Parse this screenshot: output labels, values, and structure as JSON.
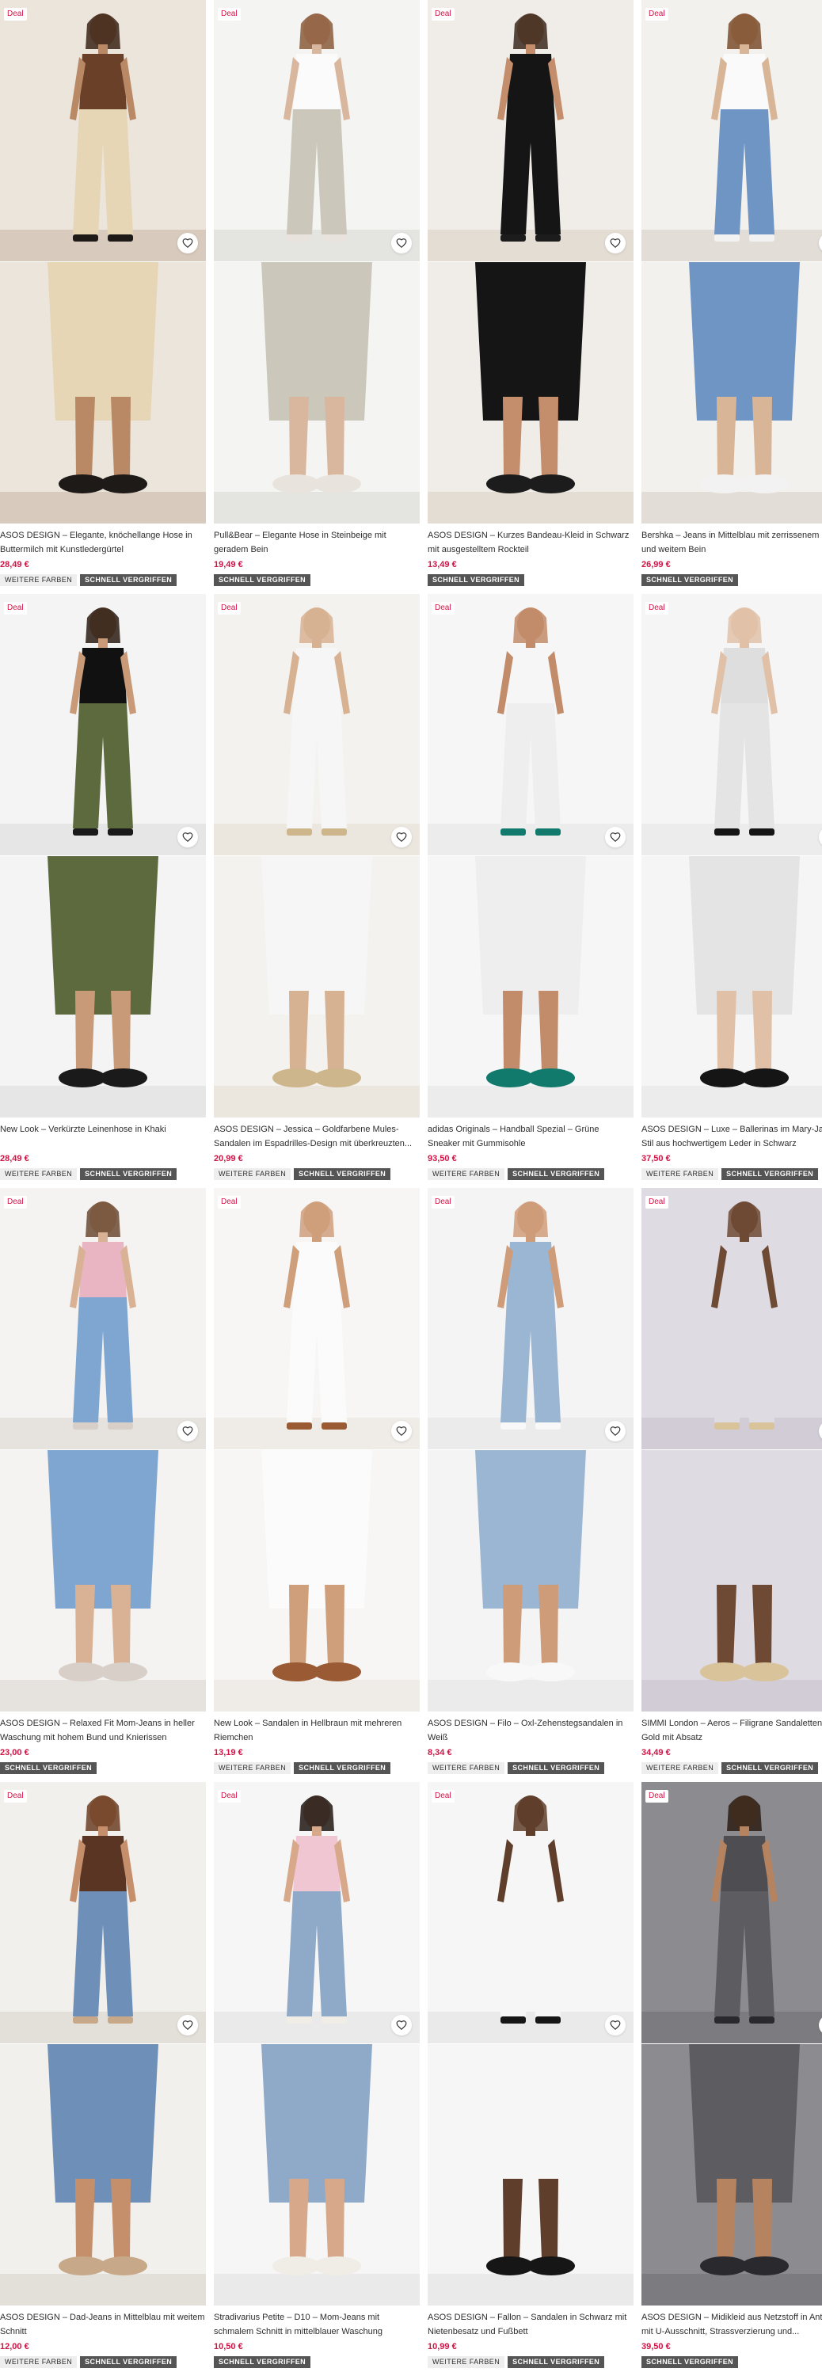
{
  "products": [
    {
      "deal": "Deal",
      "title": "ASOS DESIGN – Elegante, knöchellange Hose in Buttermilch mit Kunstledergürtel",
      "price": "28,49 €",
      "badges": [
        "WEITERE FARBEN",
        "SCHNELL VERGRIFFEN"
      ],
      "colors": {
        "bg": "#ece5dc",
        "floor": "#d8cbbd",
        "skin": "#b98966",
        "top": "#6b4028",
        "bottom": "#e6d6b6",
        "shoe": "#1e1a18",
        "hair": "#3b2416"
      }
    },
    {
      "deal": "Deal",
      "title": "Pull&Bear – Elegante Hose in Steinbeige mit geradem Bein",
      "price": "19,49 €",
      "badges": [
        "SCHNELL VERGRIFFEN"
      ],
      "colors": {
        "bg": "#f4f4f2",
        "floor": "#e4e4e1",
        "skin": "#d9b69e",
        "top": "#fbfbfb",
        "bottom": "#cbc8bb",
        "shoe": "#e8e4dd",
        "hair": "#8a5b3a"
      }
    },
    {
      "deal": "Deal",
      "title": "ASOS DESIGN – Kurzes Bandeau-Kleid in Schwarz mit ausgestelltem Rockteil",
      "price": "13,49 €",
      "badges": [
        "SCHNELL VERGRIFFEN"
      ],
      "colors": {
        "bg": "#f0ede9",
        "floor": "#e4ddd4",
        "skin": "#c48e6c",
        "top": "#151515",
        "bottom": "#151515",
        "shoe": "#1c1c1c",
        "hair": "#3b281c"
      }
    },
    {
      "deal": "Deal",
      "title": "Bershka – Jeans in Mittelblau mit zerrissenem Knie und weitem Bein",
      "price": "26,99 €",
      "badges": [
        "SCHNELL VERGRIFFEN"
      ],
      "colors": {
        "bg": "#f3f1ee",
        "floor": "#e2ddd6",
        "skin": "#d9b598",
        "top": "#fafafa",
        "bottom": "#6f95c4",
        "shoe": "#f2f2f2",
        "hair": "#7a4d2c"
      }
    },
    {
      "deal": "Deal",
      "title": "New Look – Verkürzte Leinenhose in Khaki",
      "price": "28,49 €",
      "badges": [
        "WEITERE FARBEN",
        "SCHNELL VERGRIFFEN"
      ],
      "colors": {
        "bg": "#f4f4f4",
        "floor": "#e6e6e6",
        "skin": "#c99a78",
        "top": "#111111",
        "bottom": "#5d6a3e",
        "shoe": "#1a1a1a",
        "hair": "#2a1b12"
      }
    },
    {
      "deal": "Deal",
      "title": "ASOS DESIGN – Jessica – Goldfarbene Mules-Sandalen im Espadrilles-Design mit überkreuzten...",
      "price": "20,99 €",
      "badges": [
        "WEITERE FARBEN",
        "SCHNELL VERGRIFFEN"
      ],
      "colors": {
        "bg": "#f4f2ee",
        "floor": "#ebe6de",
        "skin": "#d7b292",
        "top": "#f6f6f6",
        "bottom": "#f6f6f6",
        "shoe": "#cdb58c",
        "hair": "#d7b292"
      }
    },
    {
      "deal": "Deal",
      "title": "adidas Originals – Handball Spezial – Grüne Sneaker mit Gummisohle",
      "price": "93,50 €",
      "badges": [
        "WEITERE FARBEN",
        "SCHNELL VERGRIFFEN"
      ],
      "colors": {
        "bg": "#f6f6f6",
        "floor": "#ececec",
        "skin": "#c28c6a",
        "top": "#f6f6f6",
        "bottom": "#eeeeee",
        "shoe": "#117a6c",
        "hair": "#c28c6a"
      }
    },
    {
      "deal": "Deal",
      "title": "ASOS DESIGN – Luxe – Ballerinas im Mary-Jane-Stil aus hochwertigem Leder in Schwarz",
      "price": "37,50 €",
      "badges": [
        "WEITERE FARBEN",
        "SCHNELL VERGRIFFEN"
      ],
      "colors": {
        "bg": "#f5f5f5",
        "floor": "#ececec",
        "skin": "#e0c1a8",
        "top": "#dedede",
        "bottom": "#e4e4e4",
        "shoe": "#151515",
        "hair": "#e0c1a8"
      }
    },
    {
      "deal": "Deal",
      "title": "ASOS DESIGN – Relaxed Fit Mom-Jeans in heller Waschung mit hohem Bund und Knierissen",
      "price": "23,00 €",
      "badges": [
        "SCHNELL VERGRIFFEN"
      ],
      "colors": {
        "bg": "#f4f3f1",
        "floor": "#e6e3de",
        "skin": "#d9b295",
        "top": "#e9b5c3",
        "bottom": "#7ea6d1",
        "shoe": "#d8d0c8",
        "hair": "#6b4a33"
      }
    },
    {
      "deal": "Deal",
      "title": "New Look – Sandalen in Hellbraun mit mehreren Riemchen",
      "price": "13,19 €",
      "badges": [
        "WEITERE FARBEN",
        "SCHNELL VERGRIFFEN"
      ],
      "colors": {
        "bg": "#f7f6f4",
        "floor": "#efebe6",
        "skin": "#cf9f7c",
        "top": "#fbfbfb",
        "bottom": "#fbfbfb",
        "shoe": "#9a5a34",
        "hair": "#cf9f7c"
      }
    },
    {
      "deal": "Deal",
      "title": "ASOS DESIGN – Filo – Oxl-Zehenstegsandalen in Weiß",
      "price": "8,34 €",
      "badges": [
        "WEITERE FARBEN",
        "SCHNELL VERGRIFFEN"
      ],
      "colors": {
        "bg": "#f4f4f4",
        "floor": "#ebebeb",
        "skin": "#cf9c7a",
        "top": "#9ab6d3",
        "bottom": "#9ab6d3",
        "shoe": "#f8f8f8",
        "hair": "#cf9c7a"
      }
    },
    {
      "deal": "Deal",
      "title": "SIMMI London – Aeros – Filigrane Sandaletten in Gold mit Absatz",
      "price": "34,49 €",
      "badges": [
        "WEITERE FARBEN",
        "SCHNELL VERGRIFFEN"
      ],
      "colors": {
        "bg": "#dfdbe3",
        "floor": "#d2ccd7",
        "skin": "#6e4a35",
        "top": "#dfdbe3",
        "bottom": "#dfdbe3",
        "shoe": "#d9c39a",
        "hair": "#6e4a35"
      }
    },
    {
      "deal": "Deal",
      "title": "ASOS DESIGN – Dad-Jeans in Mittelblau mit weitem Schnitt",
      "price": "12,00 €",
      "badges": [
        "WEITERE FARBEN",
        "SCHNELL VERGRIFFEN"
      ],
      "colors": {
        "bg": "#f2f0ed",
        "floor": "#e3dfd9",
        "skin": "#c58f6c",
        "top": "#5b3524",
        "bottom": "#6e8fb8",
        "shoe": "#c7a98a",
        "hair": "#6b3e22"
      }
    },
    {
      "deal": "Deal",
      "title": "Stradivarius Petite – D10 – Mom-Jeans mit schmalem Schnitt in mittelblauer Waschung",
      "price": "10,50 €",
      "badges": [
        "SCHNELL VERGRIFFEN"
      ],
      "colors": {
        "bg": "#f6f6f6",
        "floor": "#eaeaea",
        "skin": "#d7a98a",
        "top": "#f1c6d3",
        "bottom": "#8fa9c9",
        "shoe": "#f0ece6",
        "hair": "#1e1612"
      }
    },
    {
      "deal": "Deal",
      "title": "ASOS DESIGN – Fallon – Sandalen in Schwarz mit Nietenbesatz und Fußbett",
      "price": "10,99 €",
      "badges": [
        "WEITERE FARBEN",
        "SCHNELL VERGRIFFEN"
      ],
      "colors": {
        "bg": "#f6f6f6",
        "floor": "#eaeaea",
        "skin": "#5f3f2c",
        "top": "#f6f6f6",
        "bottom": "#f6f6f6",
        "shoe": "#161616",
        "hair": "#5f3f2c"
      }
    },
    {
      "deal": "Deal",
      "title": "ASOS DESIGN – Midikleid aus Netzstoff in Anthrazit mit U-Ausschnitt, Strassverzierung und...",
      "price": "39,50 €",
      "badges": [
        "SCHNELL VERGRIFFEN"
      ],
      "colors": {
        "bg": "#8c8b90",
        "floor": "#7c7b80",
        "skin": "#b5835f",
        "top": "#4e4d52",
        "bottom": "#5d5c61",
        "shoe": "#2a2a2e",
        "hair": "#2c1c14"
      }
    }
  ],
  "icons": {
    "favourite": "heart-outline-icon"
  },
  "theme": {
    "price_color": "#d01345",
    "deal_color": "#d01345",
    "badge_dark": "#555555",
    "badge_light": "#eeeeee"
  }
}
